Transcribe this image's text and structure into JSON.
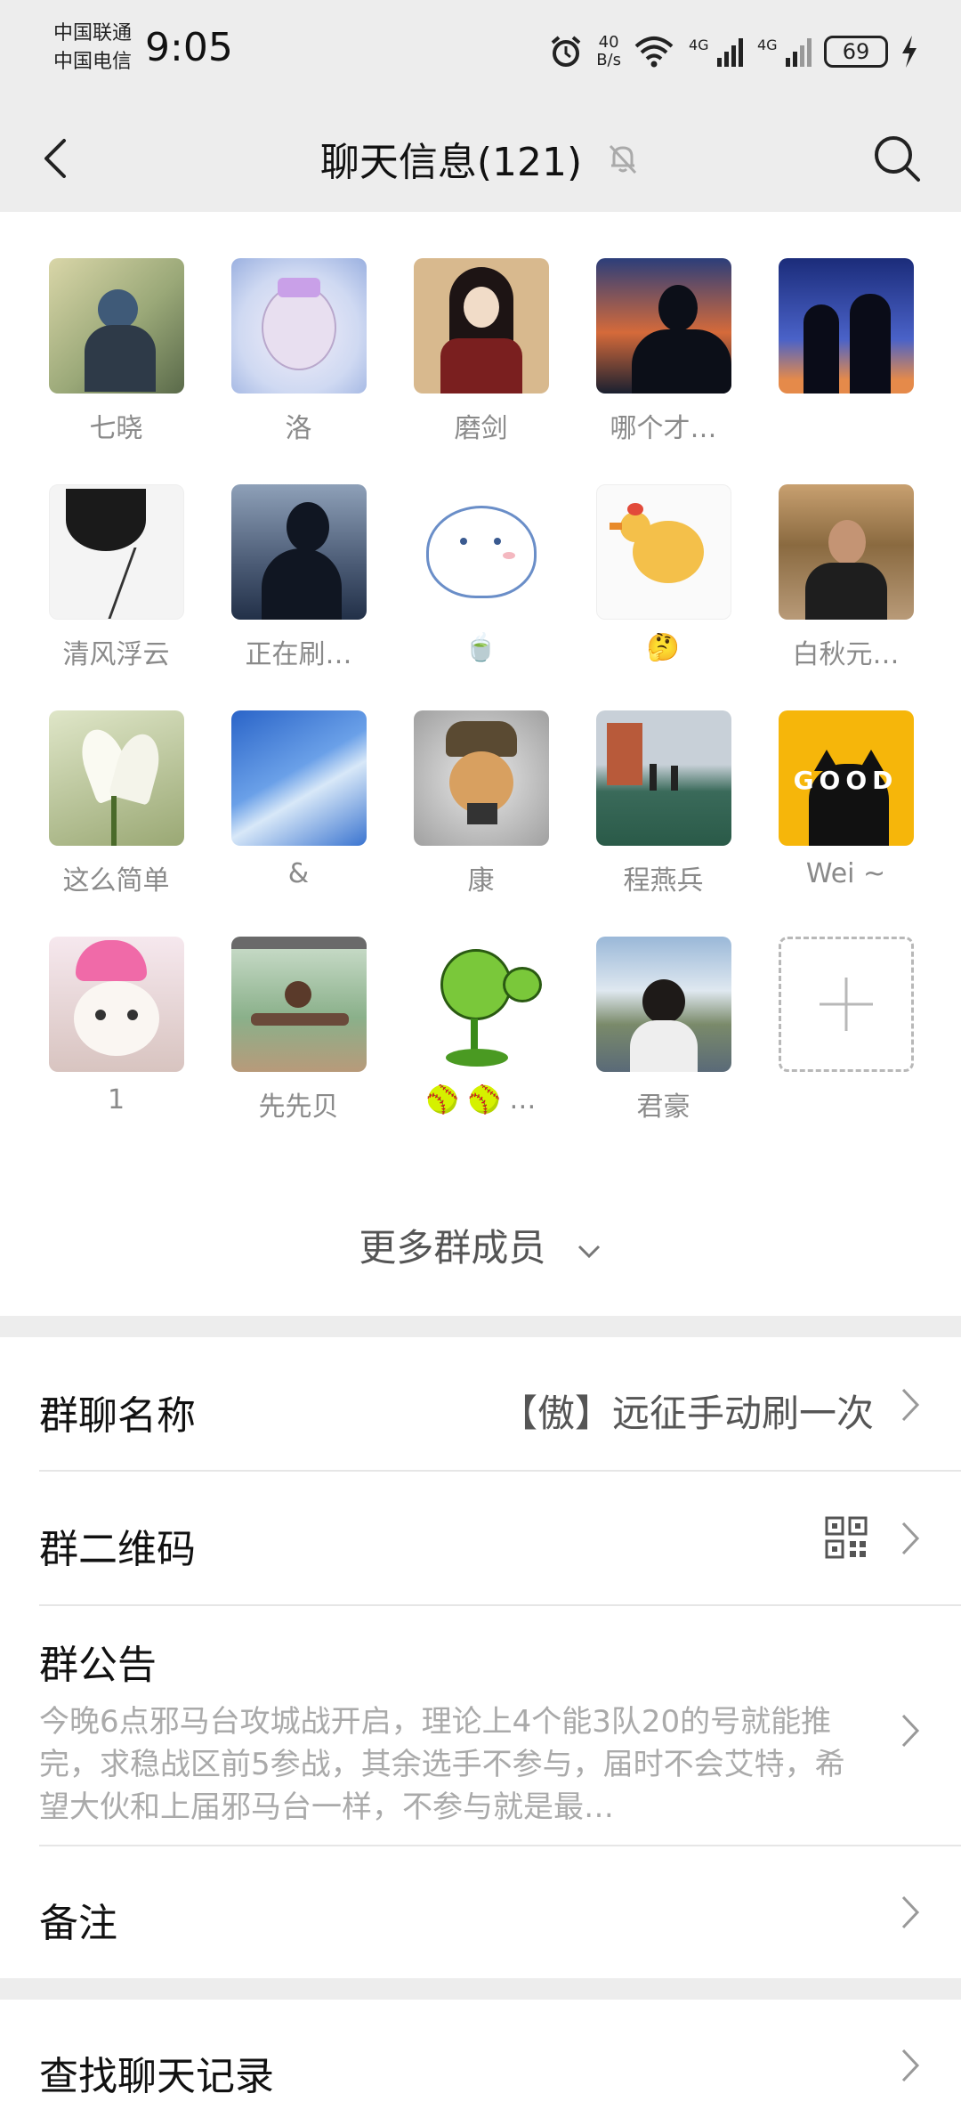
{
  "status_bar": {
    "carrier1": "中国联通",
    "carrier2": "中国电信",
    "time": "9:05",
    "net_speed_value": "40",
    "net_speed_unit": "B/s",
    "sig1_label": "4G",
    "sig2_label": "4G",
    "battery": "69"
  },
  "header": {
    "title": "聊天信息(121)"
  },
  "members": [
    {
      "name": "七晓"
    },
    {
      "name": "洛"
    },
    {
      "name": "磨剑"
    },
    {
      "name": "哪个才…"
    },
    {
      "name": ""
    },
    {
      "name": "清风浮云"
    },
    {
      "name": "正在刷…"
    },
    {
      "name": "🍵"
    },
    {
      "name": "🤔"
    },
    {
      "name": "白秋元…"
    },
    {
      "name": "这么简单"
    },
    {
      "name": "&"
    },
    {
      "name": "康"
    },
    {
      "name": "程燕兵"
    },
    {
      "name": "Wei ~"
    },
    {
      "name": "1"
    },
    {
      "name": "先先贝"
    },
    {
      "name": "🥎 🥎 …"
    },
    {
      "name": "君豪"
    }
  ],
  "avatar_good_text": "GOOD",
  "more_members": "更多群成员",
  "settings": {
    "group_name_label": "群聊名称",
    "group_name_value": "【傲】远征手动刷一次",
    "qr_label": "群二维码",
    "notice_label": "群公告",
    "notice_text": "今晚6点邪马台攻城战开启，理论上4个能3队20的号就能推完，求稳战区前5参战，其余选手不参与，届时不会艾特，希望大伙和上届邪马台一样，不参与就是最…",
    "remark_label": "备注",
    "search_history_label": "查找聊天记录"
  },
  "colors": {
    "background": "#ededed",
    "card": "#ffffff",
    "muted_text": "#8a8a8a"
  }
}
